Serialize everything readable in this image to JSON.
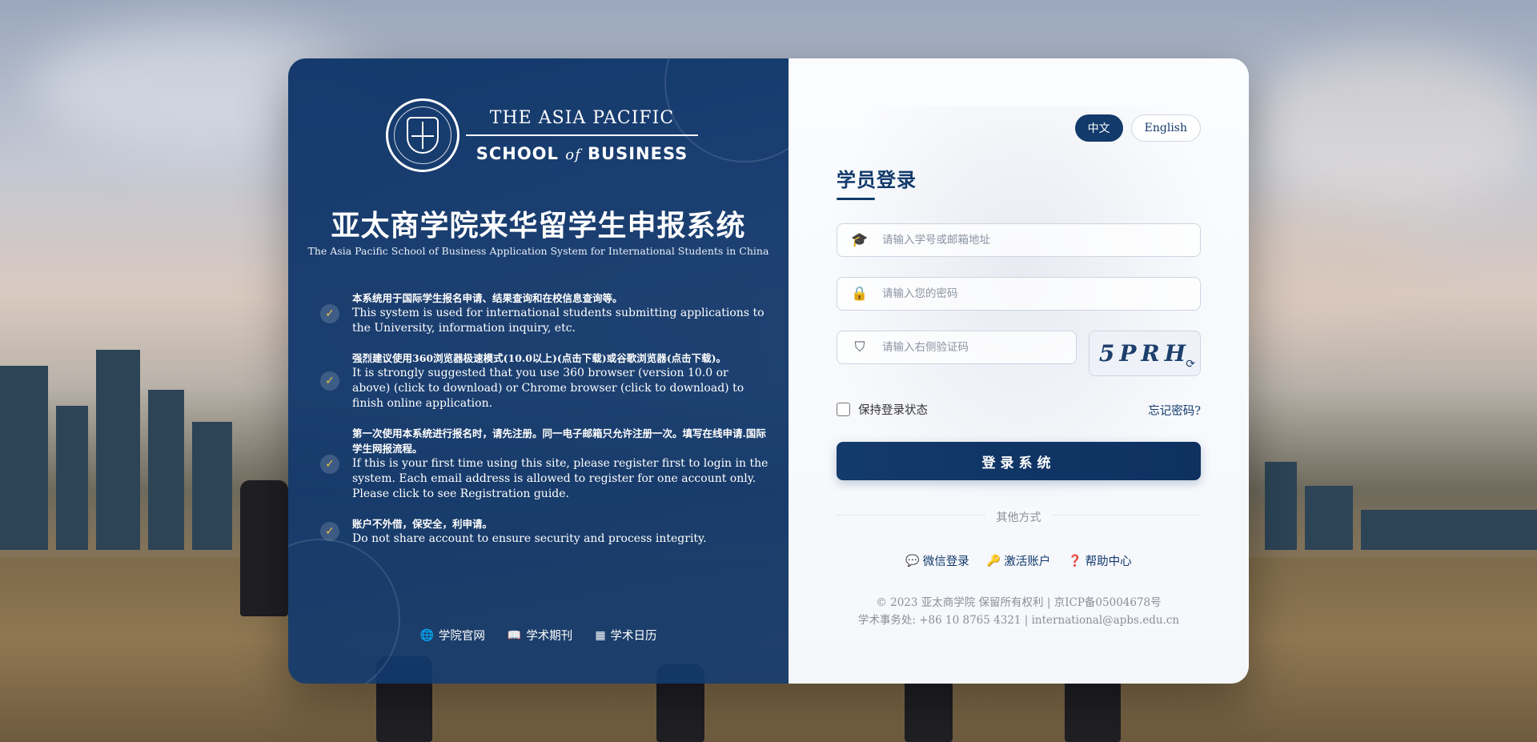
{
  "brand": {
    "logo_top": "THE ASIA PACIFIC",
    "logo_bottom_pre": "SCHOOL",
    "logo_bottom_of": "of",
    "logo_bottom_post": "BUSINESS",
    "accent": "#123a6b",
    "check_color": "#e8c04a"
  },
  "intro": {
    "title_cn": "亚太商学院来华留学生申报系统",
    "title_en": "The Asia Pacific School of Business Application System for International Students in China",
    "features": [
      {
        "cn": "本系统用于国际学生报名申请、结果查询和在校信息查询等。",
        "en": "This system is used for international students submitting applications to the University, information inquiry, etc."
      },
      {
        "cn": "强烈建议使用360浏览器极速模式(10.0以上)(点击下载)或谷歌浏览器(点击下载)。",
        "en": "It is strongly suggested that you use 360 browser (version 10.0 or above) (click to download) or Chrome browser (click to download) to finish online application."
      },
      {
        "cn": "第一次使用本系统进行报名时，请先注册。同一电子邮箱只允许注册一次。填写在线申请.国际学生网报流程。",
        "en": "If this is your first time using this site, please register first to login in the system. Each email address is allowed to register for one account only. Please click to see Registration guide."
      },
      {
        "cn": "账户不外借，保安全，利申请。",
        "en": "Do not share account to ensure security and process integrity."
      }
    ],
    "footer_links": [
      {
        "icon": "globe-icon",
        "label": "学院官网"
      },
      {
        "icon": "book-icon",
        "label": "学术期刊"
      },
      {
        "icon": "calendar-icon",
        "label": "学术日历"
      }
    ]
  },
  "lang": {
    "zh": "中文",
    "en": "English"
  },
  "login": {
    "title": "学员登录",
    "username_placeholder": "请输入学号或邮箱地址",
    "password_placeholder": "请输入您的密码",
    "captcha_placeholder": "请输入右侧验证码",
    "captcha_code": "5PRH",
    "remember": "保持登录状态",
    "forgot": "忘记密码?",
    "submit": "登录系统",
    "other": "其他方式",
    "links": [
      {
        "icon": "wechat-icon",
        "label": "微信登录"
      },
      {
        "icon": "key-icon",
        "label": "激活账户"
      },
      {
        "icon": "help-icon",
        "label": "帮助中心"
      }
    ],
    "copyright": "© 2023 亚太商学院 保留所有权利 | 京ICP备05004678号",
    "contact": "学术事务处: +86 10 8765 4321 | international@apbs.edu.cn"
  }
}
